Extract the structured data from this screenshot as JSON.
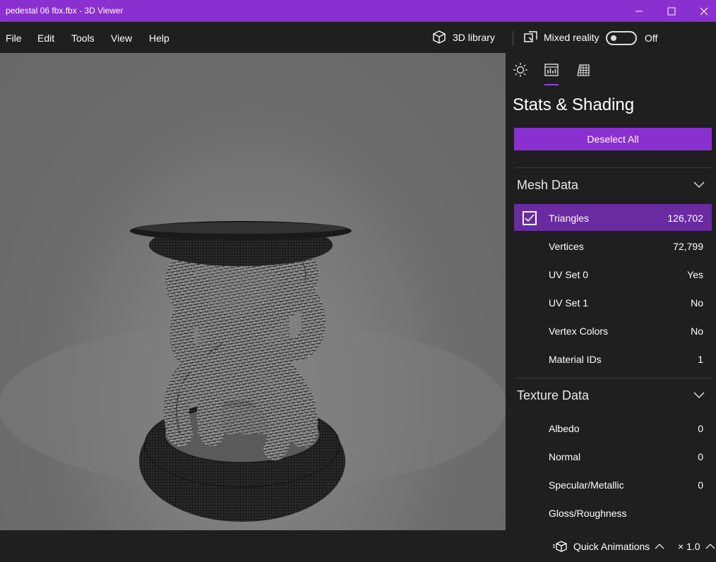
{
  "window": {
    "title": "pedestal 06 fbx.fbx - 3D Viewer"
  },
  "menu": {
    "items": [
      {
        "label": "File"
      },
      {
        "label": "Edit"
      },
      {
        "label": "Tools"
      },
      {
        "label": "View"
      },
      {
        "label": "Help"
      }
    ],
    "library_label": "3D library",
    "mixed_reality_label": "Mixed reality",
    "mixed_reality_state": "Off"
  },
  "panel": {
    "tabs": [
      {
        "icon": "sun-icon"
      },
      {
        "icon": "stats-icon",
        "active": true
      },
      {
        "icon": "grid-icon"
      }
    ],
    "title": "Stats & Shading",
    "deselect_label": "Deselect All",
    "mesh_section": {
      "title": "Mesh Data",
      "rows": [
        {
          "label": "Triangles",
          "value": "126,702",
          "checked": true
        },
        {
          "label": "Vertices",
          "value": "72,799"
        },
        {
          "label": "UV Set 0",
          "value": "Yes"
        },
        {
          "label": "UV Set 1",
          "value": "No"
        },
        {
          "label": "Vertex Colors",
          "value": "No"
        },
        {
          "label": "Material IDs",
          "value": "1"
        }
      ]
    },
    "texture_section": {
      "title": "Texture Data",
      "rows": [
        {
          "label": "Albedo",
          "value": "0"
        },
        {
          "label": "Normal",
          "value": "0"
        },
        {
          "label": "Specular/Metallic",
          "value": "0"
        },
        {
          "label": "Gloss/Roughness",
          "value": ""
        }
      ]
    }
  },
  "bottom": {
    "quick_animations_label": "Quick Animations",
    "speed_label": "× 1.0"
  },
  "colors": {
    "accent": "#8a2fd0",
    "selected_row": "#6a2aa0",
    "background": "#1f1f1f"
  }
}
